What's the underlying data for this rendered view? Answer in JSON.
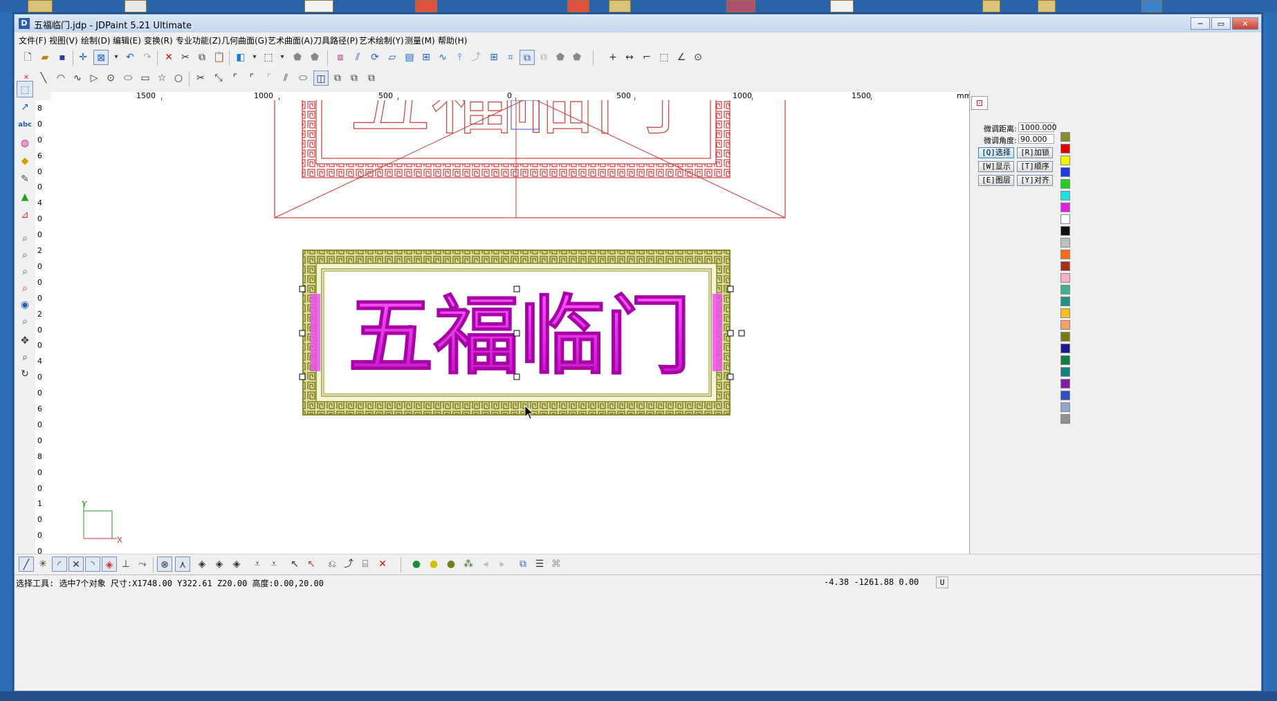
{
  "window": {
    "title": "五福临门.jdp - JDPaint 5.21 Ultimate",
    "app_icon": "D"
  },
  "window_controls": {
    "minimize": "─",
    "maximize": "▭",
    "close": "✕"
  },
  "menu": [
    "文件(F)",
    "视图(V)",
    "绘制(D)",
    "编辑(E)",
    "变换(R)",
    "专业功能(Z)",
    "几何曲面(G)",
    "艺术曲面(A)",
    "刀具路径(P)",
    "艺术绘制(Y)",
    "测量(M)",
    "帮助(H)"
  ],
  "ruler": {
    "h_labels": [
      "1500",
      "1000",
      "500",
      "0",
      "500",
      "1000",
      "1500"
    ],
    "unit": "mm",
    "v_labels": [
      "8",
      "0",
      "0",
      "6",
      "0",
      "0",
      "4",
      "0",
      "0",
      "2",
      "0",
      "0",
      "0",
      "2",
      "0",
      "0",
      "4",
      "0",
      "0",
      "6",
      "0",
      "0",
      "8",
      "0",
      "0",
      "1",
      "0",
      "0",
      "0"
    ]
  },
  "canvas": {
    "text_outline": "五福临门",
    "text_main": "五福临门",
    "axis_y": "Y",
    "axis_x": "X",
    "colors": {
      "red_outline": "#d03a3a",
      "frame_olive": "#a8a638",
      "text_magenta": "#e020e0"
    }
  },
  "panel": {
    "distance_label": "微调距离:",
    "distance_value": "1000.000",
    "angle_label": "微调角度:",
    "angle_value": "90.000",
    "buttons": [
      "[Q]选择",
      "[R]加锁",
      "[W]显示",
      "[T]顺序",
      "[E]图层",
      "[Y]对齐"
    ]
  },
  "palette": [
    "#8c8c30",
    "#e00000",
    "#f5f500",
    "#1a3cdc",
    "#20d020",
    "#20e0e0",
    "#e020e0",
    "#ffffff",
    "#101010",
    "#c0c0c0",
    "#ff6a20",
    "#a83020",
    "#f6b0c0",
    "#40b090",
    "#209080",
    "#f0c020",
    "#f0a060",
    "#7a7a10",
    "#1a1a90",
    "#108040",
    "#108080",
    "#8020a0",
    "#3050c0",
    "#90a8d0",
    "#909090"
  ],
  "status": {
    "left": "选择工具: 选中7个对象 尺寸:X1748.00 Y322.61 Z20.00 高度:0.00,20.00",
    "coords": "-4.38 -1261.88 0.00",
    "mode": "U"
  }
}
